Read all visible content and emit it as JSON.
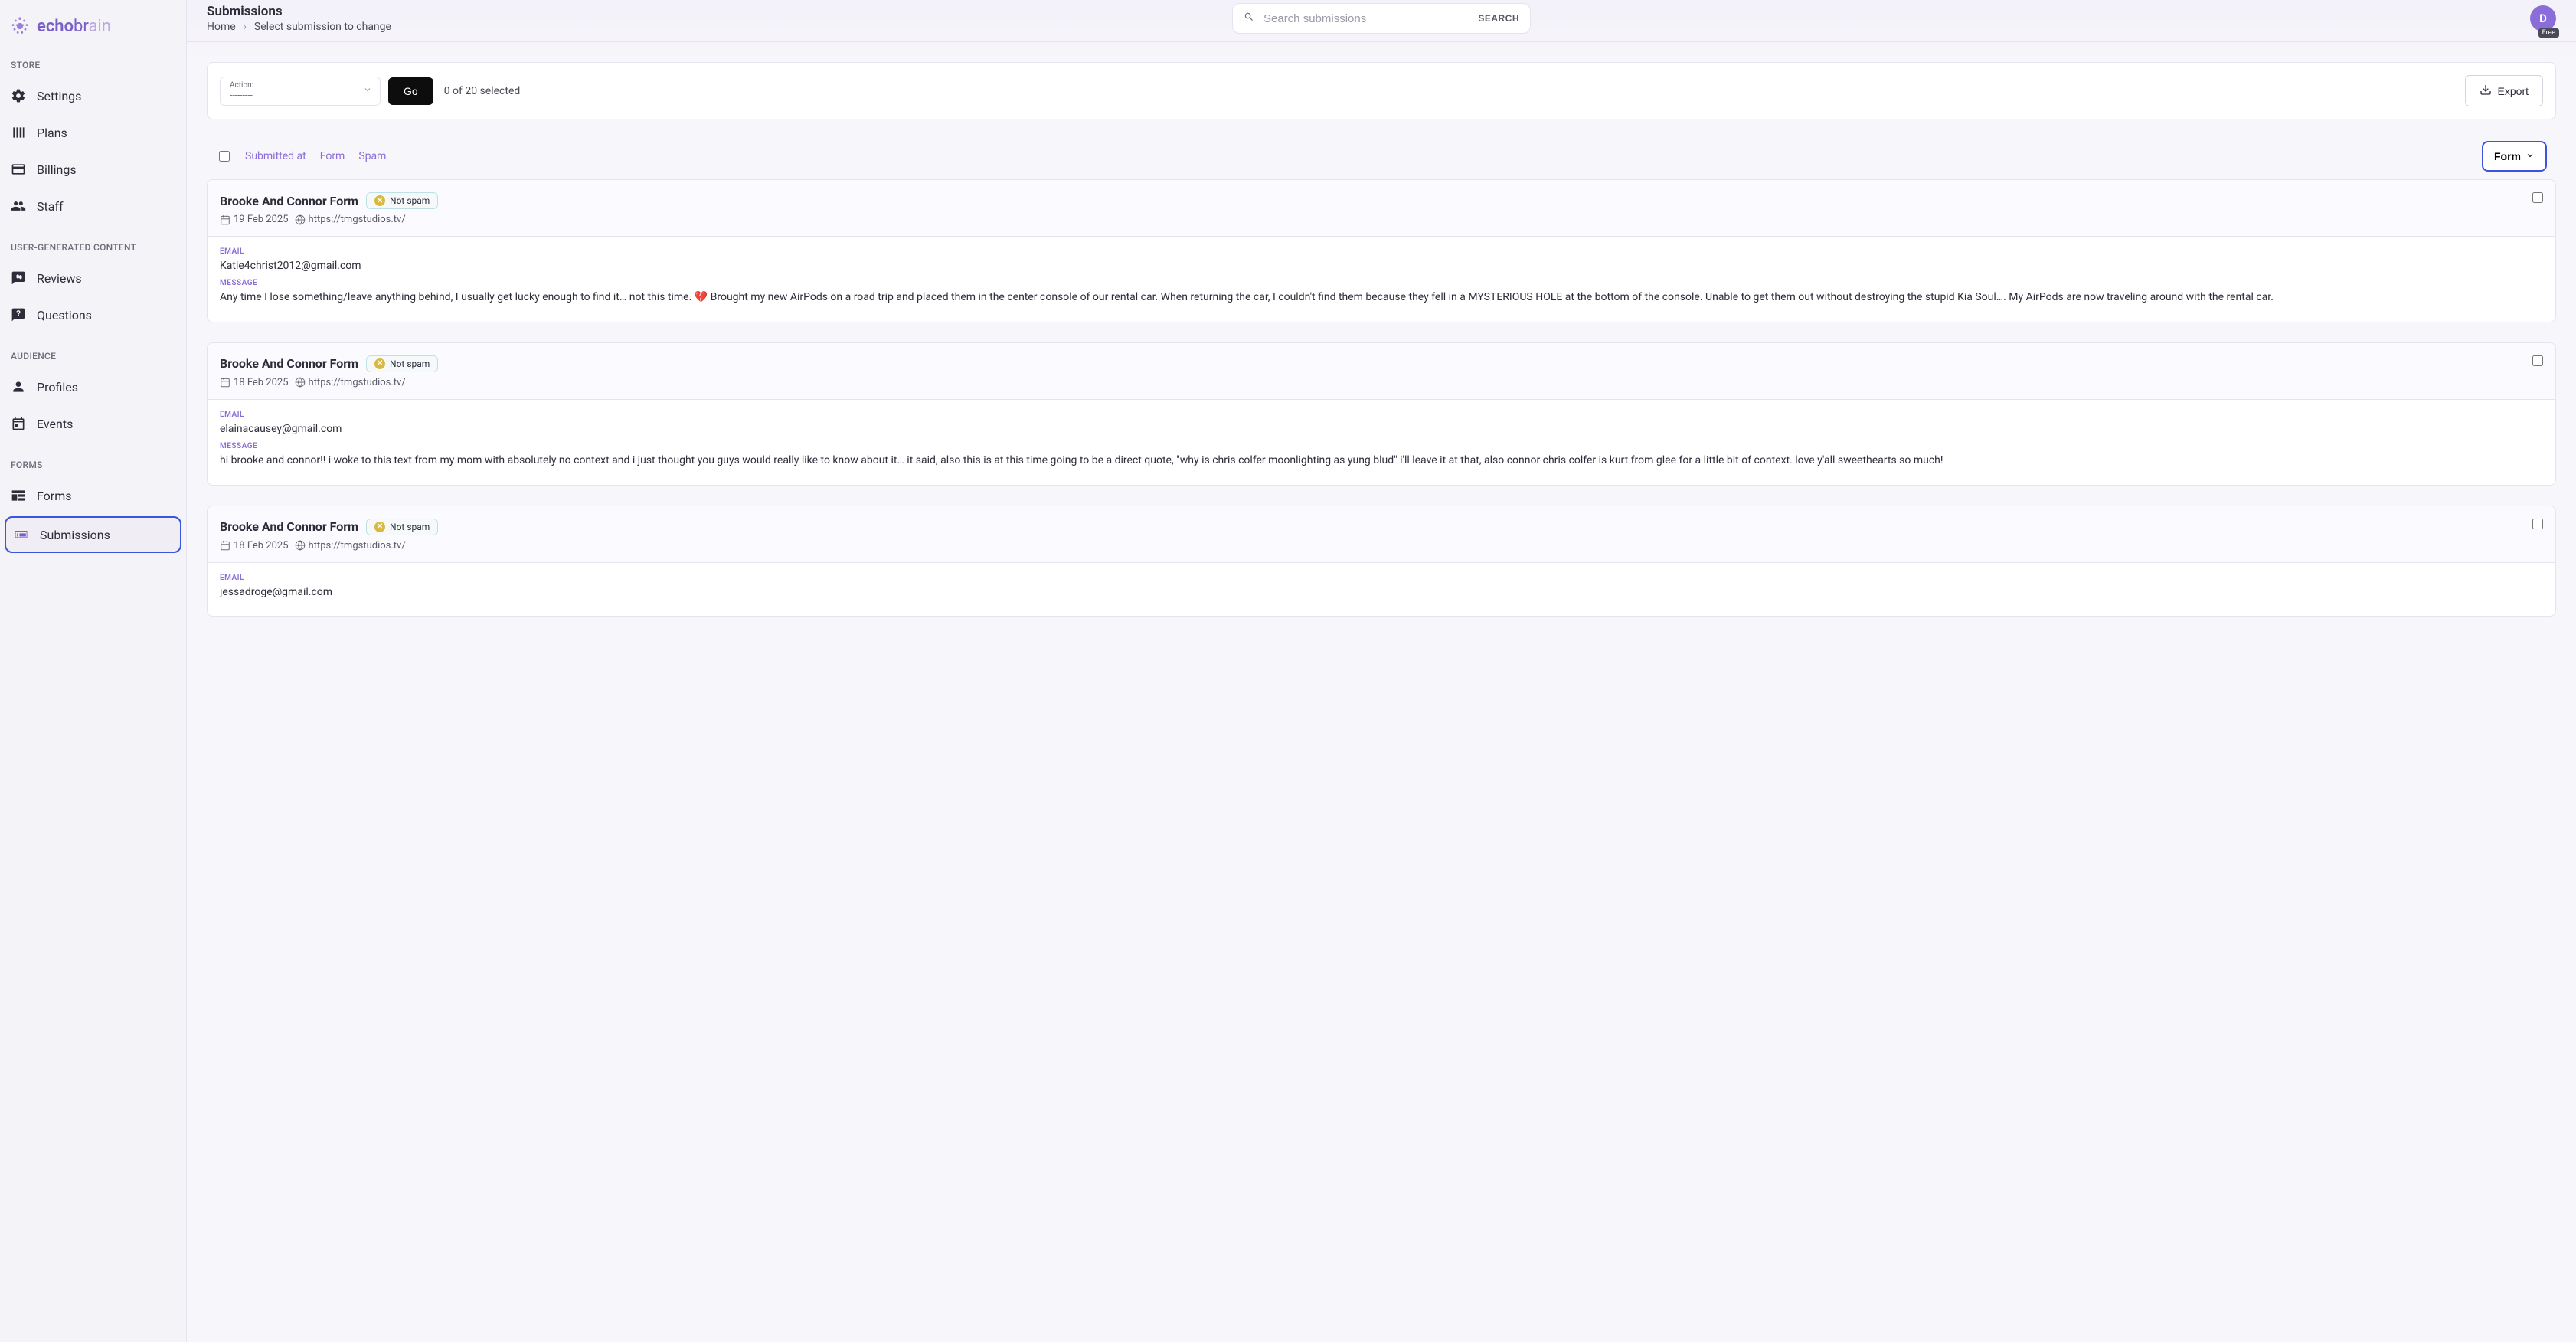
{
  "brand": {
    "name_bold": "echo",
    "name_mid": "br",
    "name_light": "ain"
  },
  "sidebar": {
    "sections": [
      {
        "label": "STORE",
        "items": [
          {
            "id": "settings",
            "label": "Settings",
            "icon": "gear"
          },
          {
            "id": "plans",
            "label": "Plans",
            "icon": "bars"
          },
          {
            "id": "billings",
            "label": "Billings",
            "icon": "card"
          },
          {
            "id": "staff",
            "label": "Staff",
            "icon": "people"
          }
        ]
      },
      {
        "label": "USER-GENERATED CONTENT",
        "items": [
          {
            "id": "reviews",
            "label": "Reviews",
            "icon": "review"
          },
          {
            "id": "questions",
            "label": "Questions",
            "icon": "question"
          }
        ]
      },
      {
        "label": "AUDIENCE",
        "items": [
          {
            "id": "profiles",
            "label": "Profiles",
            "icon": "person"
          },
          {
            "id": "events",
            "label": "Events",
            "icon": "event"
          }
        ]
      },
      {
        "label": "FORMS",
        "items": [
          {
            "id": "forms",
            "label": "Forms",
            "icon": "form"
          },
          {
            "id": "submissions",
            "label": "Submissions",
            "icon": "submission",
            "active": true
          }
        ]
      }
    ]
  },
  "header": {
    "title": "Submissions",
    "breadcrumb": {
      "home": "Home",
      "current": "Select submission to change"
    },
    "search_placeholder": "Search submissions",
    "search_button": "SEARCH",
    "avatar_initial": "D",
    "avatar_badge": "Free"
  },
  "action_bar": {
    "action_label": "Action:",
    "action_value": "---------",
    "go_button": "Go",
    "selection_count": "0 of 20 selected",
    "export_button": "Export"
  },
  "table_controls": {
    "sort_submitted": "Submitted at",
    "sort_form": "Form",
    "sort_spam": "Spam",
    "filter_form": "Form"
  },
  "field_labels": {
    "email": "EMAIL",
    "message": "MESSAGE"
  },
  "spam_badge": "Not spam",
  "submissions": [
    {
      "form_name": "Brooke And Connor Form",
      "date": "19 Feb 2025",
      "url": "https://tmgstudios.tv/",
      "email": "Katie4christ2012@gmail.com",
      "message": "Any time I lose something/leave anything behind, I usually get lucky enough to find it… not this time. 💔 Brought my new AirPods on a road trip and placed them in the center console of our rental car. When returning the car, I couldn't find them because they fell in a MYSTERIOUS HOLE at the bottom of the console. Unable to get them out without destroying the stupid Kia Soul…. My AirPods are now traveling around with the rental car."
    },
    {
      "form_name": "Brooke And Connor Form",
      "date": "18 Feb 2025",
      "url": "https://tmgstudios.tv/",
      "email": "elainacausey@gmail.com",
      "message": "hi brooke and connor!! i woke to this text from my mom with absolutely no context and i just thought you guys would really like to know about it… it said, also this is at this time going to be a direct quote, \"why is chris colfer moonlighting as yung blud\" i'll leave it at that, also connor chris colfer is kurt from glee for a little bit of context. love y'all sweethearts so much!"
    },
    {
      "form_name": "Brooke And Connor Form",
      "date": "18 Feb 2025",
      "url": "https://tmgstudios.tv/",
      "email": "jessadroge@gmail.com",
      "message": ""
    }
  ]
}
